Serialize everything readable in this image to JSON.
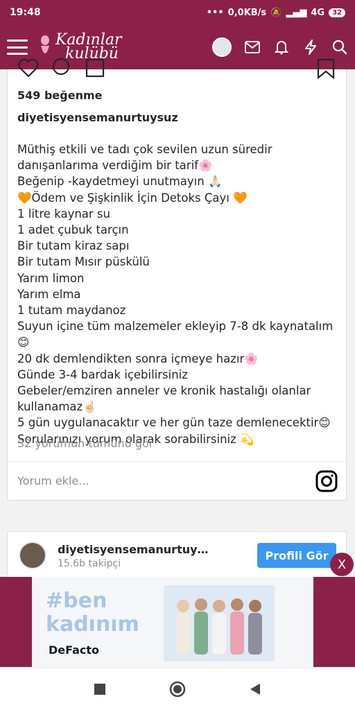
{
  "status_bar": {
    "time": "19:48",
    "network": "0,0KB/s",
    "signal": "4G",
    "battery": "32"
  },
  "app": {
    "logo_line1": "Kadınlar",
    "logo_line2": "kulübü"
  },
  "post": {
    "likes": "549 beğenme",
    "username": "diyetisyensemanurtuysuz",
    "caption": "Müthiş etkili ve tadı çok sevilen uzun süredir\ndanışanlarıma verdiğim bir tarif🌸\nBeğenip -kaydetmeyi unutmayın 🙏🏻\n🧡Ödem ve Şişkinlik İçin Detoks Çayı 🧡\n1 litre kaynar su\n1 adet çubuk tarçın\nBir tutam kiraz sapı\nBir tutam Mısır püskülü\nYarım limon\nYarım elma\n1 tutam maydanoz\nSuyun içine tüm malzemeler ekleyip 7-8 dk kaynatalım😊\n20 dk demlendikten sonra içmeye hazır🌸\nGünde 3-4 bardak içebilirsiniz\nGebeler/emziren anneler ve kronik hastalığı olanlar\nkullanamaz☝🏻\n5 gün uygulanacaktır ve her gün taze demlenecektir😊\nSorularınızı yorum olarak sorabilirsiniz 💫",
    "comments_link": "32 yorumun tümünü gör",
    "comment_placeholder": "Yorum ekle..."
  },
  "profile": {
    "name": "diyetisyensemanurtuy…",
    "followers": "15.6b takipçi",
    "button": "Profili Gör"
  },
  "close_label": "X",
  "ad": {
    "tag_line1": "#ben",
    "tag_line2": "kadınım",
    "brand": "DeFacto"
  },
  "colors": {
    "brand": "#8b2149",
    "accent": "#3897f0"
  }
}
